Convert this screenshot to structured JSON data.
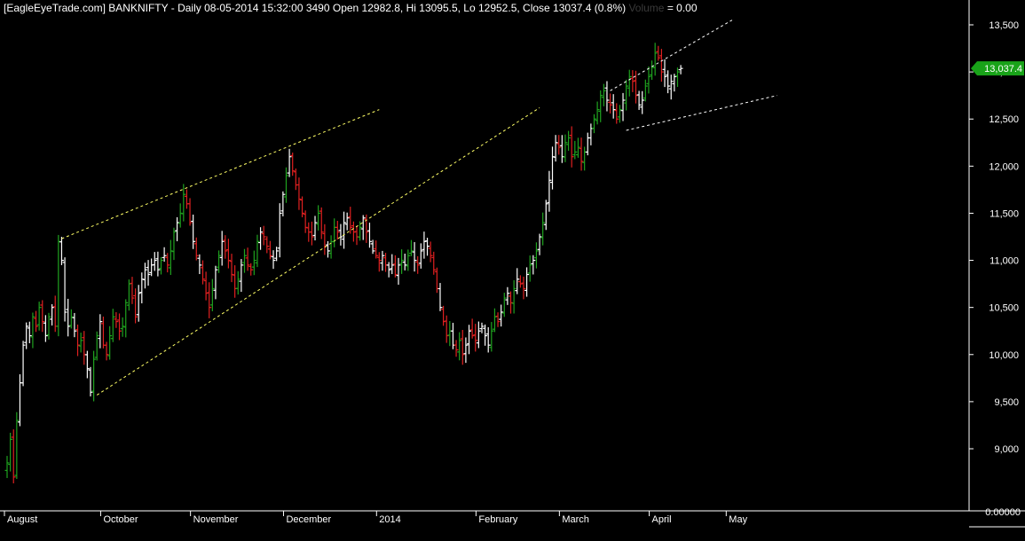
{
  "header": {
    "title": "[EagleEyeTrade.com] BANKNIFTY - Daily 08-05-2014 15:32:00 3490 Open 12982.8, Hi 13095.5, Lo 12952.5, Close 13037.4 (0.8%)",
    "volume_label": "Volume",
    "volume_value": "= 0.00"
  },
  "colors": {
    "background": "#000000",
    "up_bar": "#1fa31f",
    "down_bar": "#e02020",
    "neutral_bar": "#ffffff",
    "trendline": "#ffff66",
    "channel_line": "#ffffff",
    "price_tag_bg": "#19a319",
    "axis": "#ffffff"
  },
  "chart_data": {
    "type": "ohlc",
    "title": "BANKNIFTY - Daily",
    "ylim": [
      8600,
      13750
    ],
    "y_ticks": [
      9000,
      9500,
      10000,
      10500,
      11000,
      11500,
      12000,
      12500,
      13000,
      13500
    ],
    "y_tick_labels": [
      "9,000",
      "9,500",
      "10,000",
      "10,500",
      "11,000",
      "11,500",
      "12,000",
      "12,500",
      "13,000",
      "13,500"
    ],
    "last_price_label": "13,037.4",
    "last_price": 13037.4,
    "volume_axis_label": "0.00000",
    "x_labels": [
      {
        "label": "August",
        "bar": 0
      },
      {
        "label": "October",
        "bar": 30
      },
      {
        "label": "November",
        "bar": 58
      },
      {
        "label": "December",
        "bar": 87
      },
      {
        "label": "2014",
        "bar": 116
      },
      {
        "label": "February",
        "bar": 147
      },
      {
        "label": "March",
        "bar": 173
      },
      {
        "label": "April",
        "bar": 201
      },
      {
        "label": "May",
        "bar": 225
      }
    ],
    "n_bars": 232,
    "closes": [
      8850,
      9100,
      8700,
      9300,
      9700,
      10100,
      10300,
      10200,
      10400,
      10300,
      10500,
      10350,
      10200,
      10400,
      10500,
      10300,
      11200,
      11000,
      10450,
      10300,
      10400,
      10250,
      10100,
      10150,
      10000,
      9850,
      9600,
      9950,
      10200,
      10350,
      10100,
      10000,
      10200,
      10400,
      10350,
      10250,
      10300,
      10550,
      10750,
      10600,
      10400,
      10650,
      10800,
      10900,
      10850,
      10950,
      11000,
      10900,
      11000,
      11050,
      10950,
      11100,
      11300,
      11400,
      11500,
      11700,
      11600,
      11400,
      11200,
      11050,
      10950,
      10800,
      10650,
      10500,
      10700,
      10900,
      11050,
      11200,
      11100,
      11000,
      10850,
      10700,
      10800,
      10950,
      11050,
      10950,
      10900,
      11000,
      11200,
      11300,
      11250,
      11150,
      11050,
      11000,
      11100,
      11500,
      11700,
      11900,
      12100,
      11950,
      11800,
      11650,
      11500,
      11350,
      11300,
      11250,
      11400,
      11500,
      11300,
      11150,
      11100,
      11200,
      11350,
      11300,
      11250,
      11400,
      11450,
      11350,
      11300,
      11250,
      11350,
      11450,
      11300,
      11200,
      11100,
      11050,
      11000,
      11050,
      10950,
      10900,
      10950,
      10850,
      10950,
      11000,
      10950,
      11050,
      11100,
      11000,
      10950,
      11100,
      11200,
      11150,
      11050,
      10900,
      10700,
      10500,
      10350,
      10200,
      10250,
      10100,
      10050,
      10150,
      10000,
      10100,
      10250,
      10200,
      10150,
      10250,
      10300,
      10200,
      10100,
      10250,
      10400,
      10350,
      10450,
      10600,
      10650,
      10550,
      10700,
      10800,
      10750,
      10700,
      10850,
      10950,
      11000,
      11100,
      11250,
      11400,
      11600,
      11850,
      12100,
      12250,
      12200,
      12100,
      12250,
      12300,
      12100,
      12150,
      12200,
      12050,
      12150,
      12300,
      12400,
      12500,
      12600,
      12750,
      12800,
      12700,
      12650,
      12600,
      12500,
      12600,
      12700,
      12850,
      12950,
      12900,
      12750,
      12650,
      12700,
      12850,
      12950,
      13050,
      13200,
      13150,
      13000,
      12950,
      12850,
      12900,
      12950,
      13000,
      13037
    ],
    "trendlines": [
      {
        "style": "dashed",
        "color": "trendline",
        "from": [
          17,
          11230
        ],
        "to": [
          116,
          12600
        ]
      },
      {
        "style": "dashed",
        "color": "trendline",
        "from": [
          28,
          9570
        ],
        "to": [
          166,
          12620
        ]
      },
      {
        "style": "dashed",
        "color": "channel_line",
        "from": [
          188,
          12800
        ],
        "to": [
          226,
          13550
        ]
      },
      {
        "style": "dashed",
        "color": "channel_line",
        "from": [
          193,
          12380
        ],
        "to": [
          240,
          12750
        ]
      }
    ]
  }
}
